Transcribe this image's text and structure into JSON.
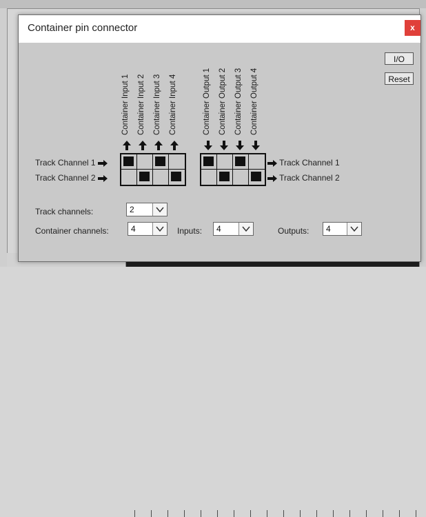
{
  "dialog": {
    "title": "Container pin connector",
    "close_label": "x",
    "io_label": "I/O",
    "reset_label": "Reset"
  },
  "columns": {
    "inputs": [
      "Container Input 1",
      "Container Input 2",
      "Container Input 3",
      "Container Input 4"
    ],
    "outputs": [
      "Container Output 1",
      "Container Output 2",
      "Container Output 3",
      "Container Output 4"
    ]
  },
  "rows": {
    "left": [
      "Track Channel 1",
      "Track Channel 2"
    ],
    "right": [
      "Track Channel 1",
      "Track Channel 2"
    ]
  },
  "input_matrix": [
    [
      true,
      false,
      true,
      false
    ],
    [
      false,
      true,
      false,
      true
    ]
  ],
  "output_matrix": [
    [
      true,
      false,
      true,
      false
    ],
    [
      false,
      true,
      false,
      true
    ]
  ],
  "form": {
    "track_channels_label": "Track channels:",
    "track_channels_value": "2",
    "container_channels_label": "Container channels:",
    "container_channels_value": "4",
    "inputs_label": "Inputs:",
    "inputs_value": "4",
    "outputs_label": "Outputs:",
    "outputs_value": "4"
  },
  "colors": {
    "close": "#e0403a",
    "panel": "#c9c9c9"
  }
}
